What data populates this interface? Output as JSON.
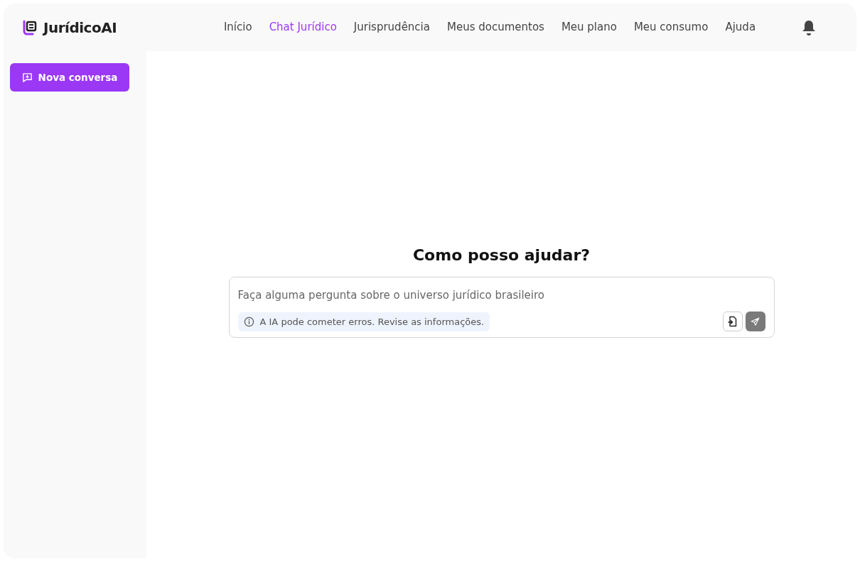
{
  "brand": {
    "name": "JurídicoAI"
  },
  "nav": [
    {
      "label": "Início",
      "selected": false
    },
    {
      "label": "Chat Jurídico",
      "selected": true
    },
    {
      "label": "Jurisprudência",
      "selected": false
    },
    {
      "label": "Meus documentos",
      "selected": false
    },
    {
      "label": "Meu plano",
      "selected": false
    },
    {
      "label": "Meu consumo",
      "selected": false
    },
    {
      "label": "Ajuda",
      "selected": false
    }
  ],
  "sidebar": {
    "new_chat_button": "Nova conversa"
  },
  "chat": {
    "heading": "Como posso ajudar?",
    "input": {
      "placeholder": "Faça alguma pergunta sobre o universo jurídico brasileiro"
    },
    "notice": "A IA pode cometer erros. Revise as informações.",
    "send_disabled": true
  }
}
